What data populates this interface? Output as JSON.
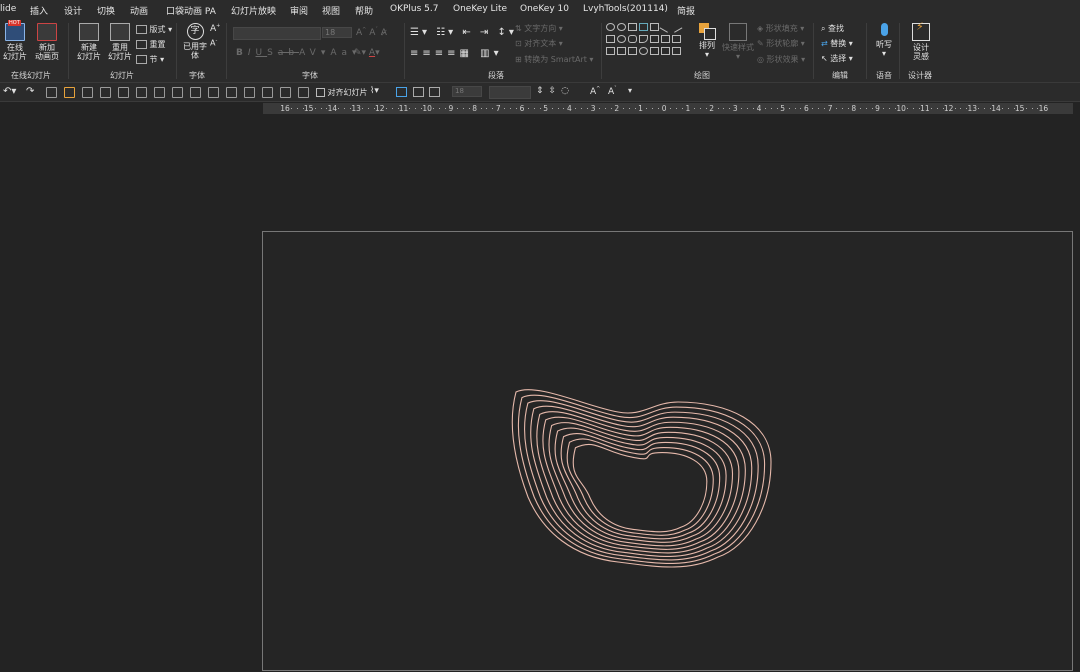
{
  "menu": [
    "lide",
    "插入",
    "设计",
    "切换",
    "动画",
    "口袋动画 PA",
    "幻灯片放映",
    "审阅",
    "视图",
    "帮助",
    "OKPlus 5.7",
    "OneKey Lite",
    "OneKey 10",
    "LvyhTools(201114)",
    "简报"
  ],
  "ribbon": {
    "online_slides": {
      "badge": "HOT",
      "line1": "在线",
      "line2": "幻灯片",
      "group": "在线幻灯片"
    },
    "new_anim_page": {
      "line1": "新加",
      "line2": "动画页"
    },
    "new_slide": {
      "line1": "新建",
      "line2": "幻灯片"
    },
    "reuse_slide": {
      "line1": "重用",
      "line2": "幻灯片"
    },
    "layout": "版式",
    "reset": "重置",
    "section": "节",
    "slides_group": "幻灯片",
    "used_font": {
      "glyph": "字",
      "line1": "已用字",
      "line2": "体"
    },
    "font_group_small": "字体",
    "font_size": "18",
    "font_group": "字体",
    "text_direction": "文字方向",
    "align_text": "对齐文本",
    "smartart": "转换为 SmartArt",
    "paragraph_group": "段落",
    "arrange": "排列",
    "quick_styles": "快速样式",
    "shape_fill": "形状填充",
    "shape_outline": "形状轮廓",
    "shape_effects": "形状效果",
    "drawing_group": "绘图",
    "find": "查找",
    "replace": "替换",
    "select": "选择",
    "editing_group": "编辑",
    "dictate": "听写",
    "voice_group": "语音",
    "designer": {
      "line1": "设计",
      "line2": "灵感"
    },
    "designer_group": "设计器"
  },
  "qat": {
    "align_slide": "对齐幻灯片",
    "size": "18"
  },
  "ruler_labels": [
    "16",
    "15",
    "14",
    "13",
    "12",
    "11",
    "10",
    "9",
    "8",
    "7",
    "6",
    "5",
    "4",
    "3",
    "2",
    "1",
    "0",
    "1",
    "2",
    "3",
    "4",
    "5",
    "6",
    "7",
    "8",
    "9",
    "10",
    "11",
    "12",
    "13",
    "14",
    "15",
    "16"
  ],
  "colors": {
    "contour": "#e6b9ab",
    "accent_orange": "#e8a33c",
    "accent_blue": "#4aa3e8",
    "hot_red": "#d9342b"
  }
}
